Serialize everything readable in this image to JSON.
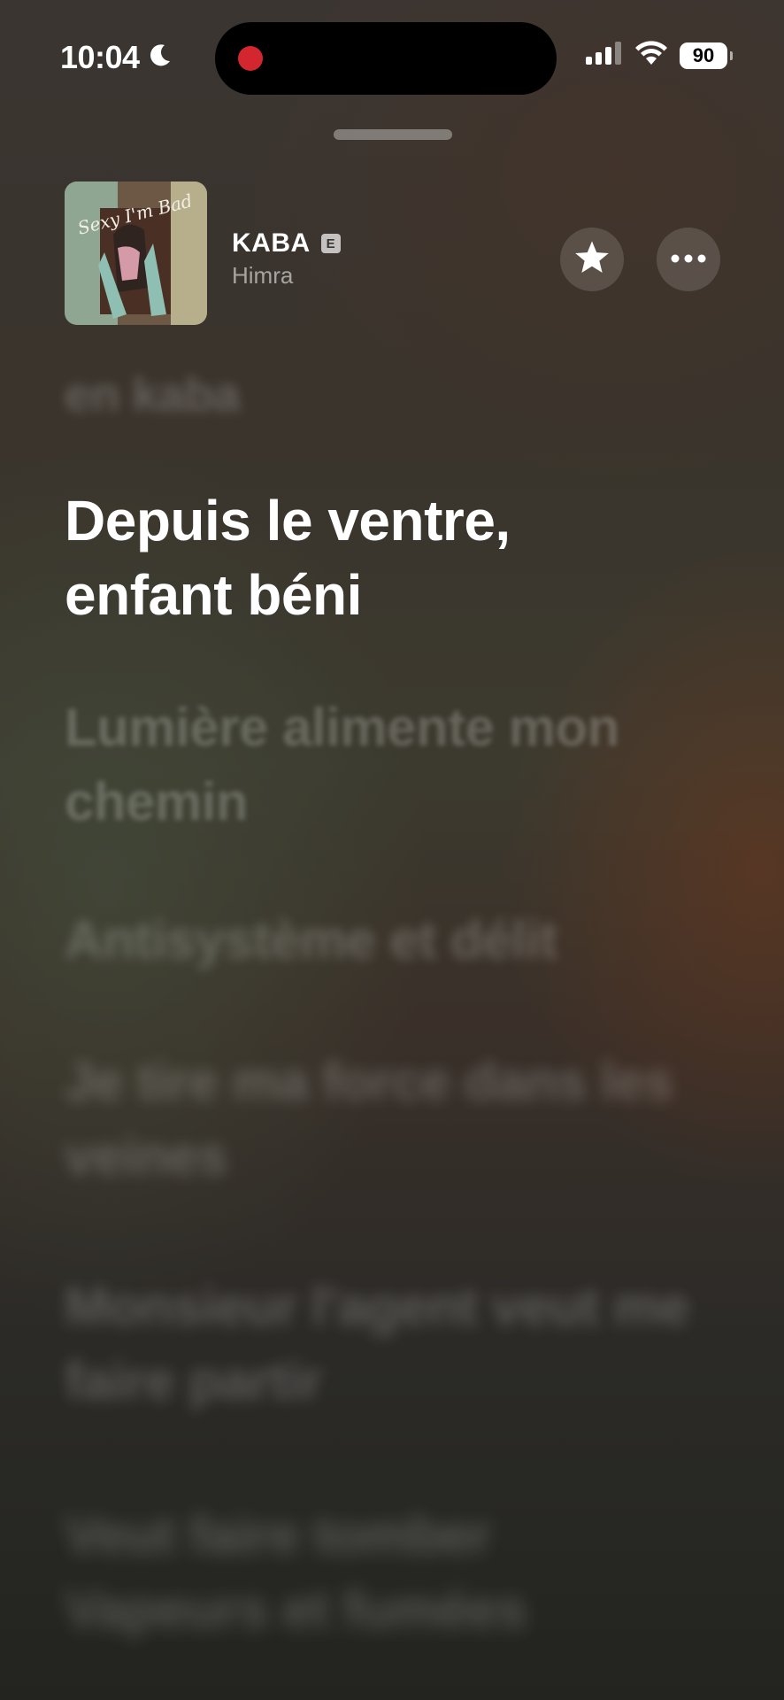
{
  "status_bar": {
    "time": "10:04",
    "focus_icon": "moon-icon",
    "battery_level": "90",
    "recording_indicator_color": "#d3262e"
  },
  "now_playing": {
    "title": "KABA",
    "explicit_badge": "E",
    "artist": "Himra",
    "artwork_text": "Sexy I'm Bad",
    "favorite_icon": "star-icon",
    "more_icon": "ellipsis-icon"
  },
  "lyrics": {
    "previous": "en kaba",
    "current": "Depuis le ventre,\nenfant béni",
    "upcoming": [
      "Lumière alimente mon chemin",
      "Antisystème et délit",
      "Je tire ma force dans les veines",
      "Monsieur l'agent veut me faire partir",
      "Veut faire tomber Vapeurs et fumées"
    ]
  }
}
